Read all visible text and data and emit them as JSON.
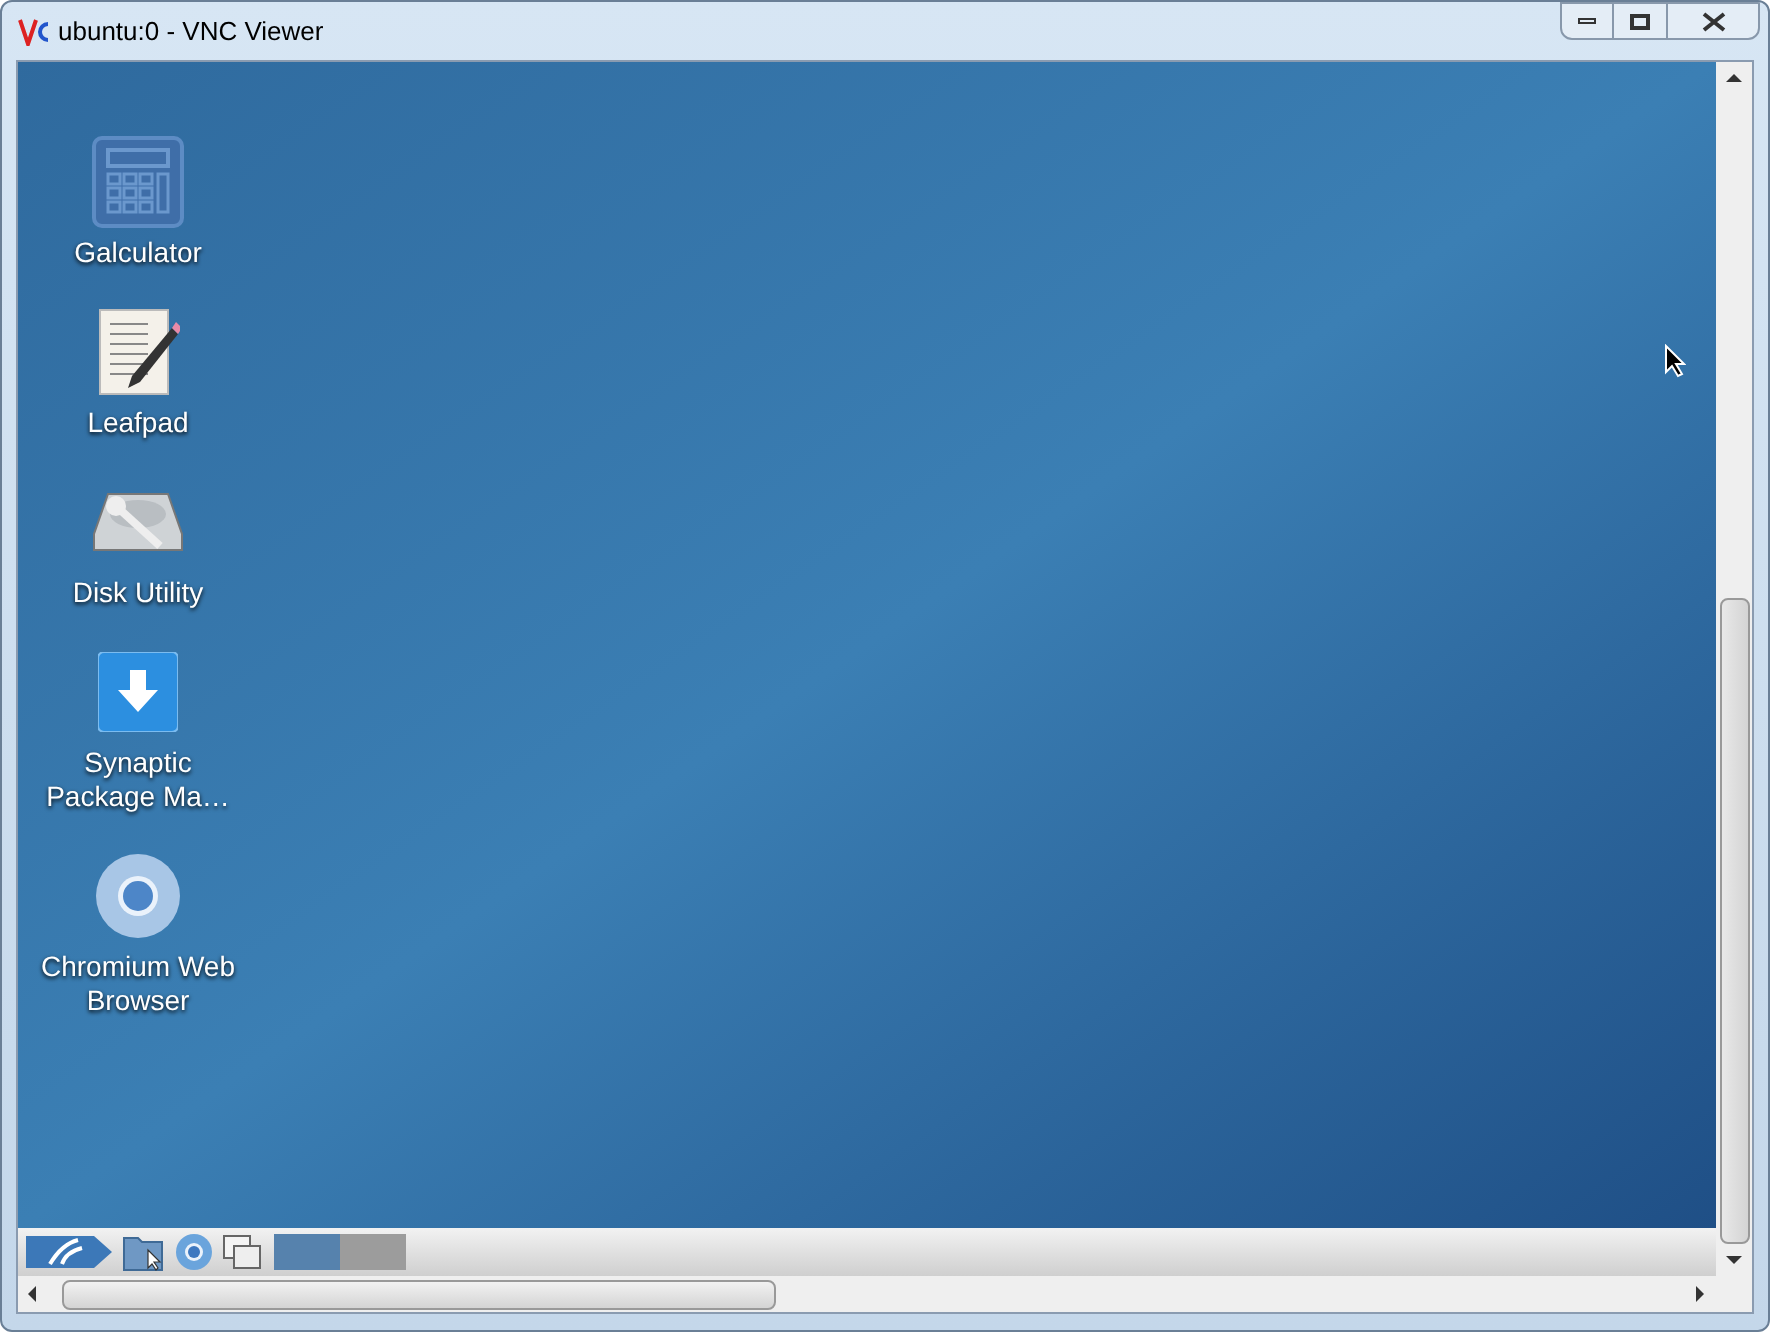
{
  "window": {
    "title": "ubuntu:0 - VNC Viewer"
  },
  "desktop_icons": [
    {
      "kind": "calculator",
      "label": "Galculator"
    },
    {
      "kind": "notepad",
      "label": "Leafpad"
    },
    {
      "kind": "disk",
      "label": "Disk Utility"
    },
    {
      "kind": "download",
      "label": "Synaptic Package Ma…"
    },
    {
      "kind": "browser",
      "label": "Chromium Web Browser"
    }
  ],
  "taskbar": {
    "workspaces": [
      {
        "selected": true
      },
      {
        "selected": false
      }
    ]
  }
}
